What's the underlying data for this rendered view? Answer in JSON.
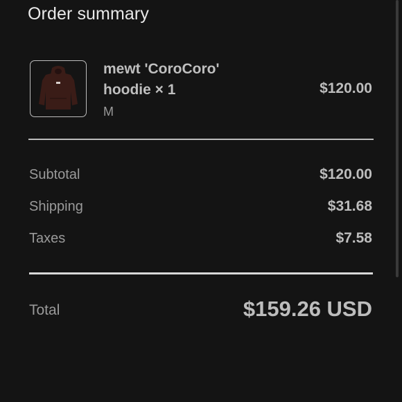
{
  "header": {
    "title": "Order summary"
  },
  "item": {
    "image_icon": "hoodie-product-image",
    "name": "mewt 'CoroCoro' hoodie × 1",
    "variant": "M",
    "price": "$120.00"
  },
  "summary": {
    "subtotal_label": "Subtotal",
    "subtotal_value": "$120.00",
    "shipping_label": "Shipping",
    "shipping_value": "$31.68",
    "taxes_label": "Taxes",
    "taxes_value": "$7.58"
  },
  "total": {
    "label": "Total",
    "value": "$159.26 USD"
  },
  "colors": {
    "background": "#141414",
    "text_primary": "#bdbdbd",
    "text_secondary": "#9a9a9a",
    "hoodie": "#3a1c17"
  }
}
